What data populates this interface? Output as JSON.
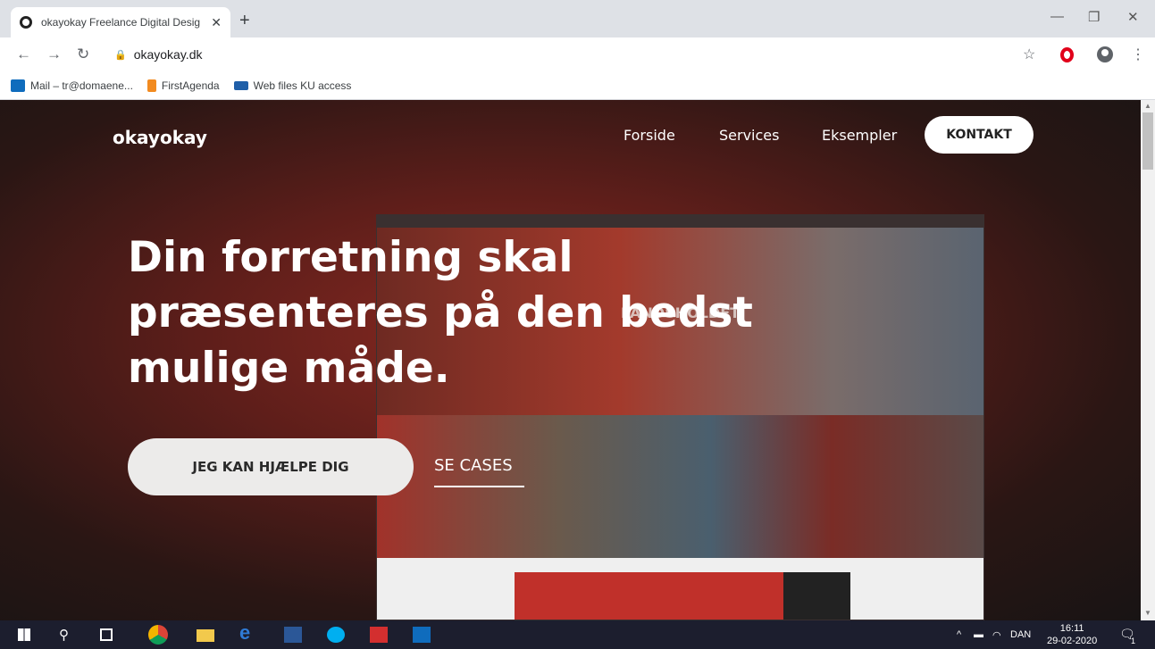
{
  "browser": {
    "tab_title": "okayokay Freelance Digital Desig",
    "tab_close": "✕",
    "new_tab": "+",
    "url": "okayokay.dk",
    "bookmarks": [
      {
        "label": "Mail – tr@domaene...",
        "icon_color": "#0f6cbd"
      },
      {
        "label": "FirstAgenda",
        "icon_color": "#f28b20"
      },
      {
        "label": "Web files KU access",
        "icon_color": "#1f5fa8"
      }
    ]
  },
  "site": {
    "logo": "okayokay",
    "nav": {
      "forside": "Forside",
      "services": "Services",
      "eksempler": "Eksempler",
      "kontakt": "KONTAKT"
    },
    "headline_lines": [
      "Din forretning skal",
      "præsenteres på den bedst",
      "mulige måde."
    ],
    "cta_primary": "JEG KAN HJÆLPE DIG",
    "cta_secondary": "SE CASES",
    "mockup_text": "LANDSHOLDET"
  },
  "taskbar": {
    "language": "DAN",
    "time": "16:11",
    "date": "29-02-2020",
    "notification_count": "1"
  },
  "colors": {
    "hero_red": "#8a2a22",
    "cta_bg": "#ecebea"
  }
}
